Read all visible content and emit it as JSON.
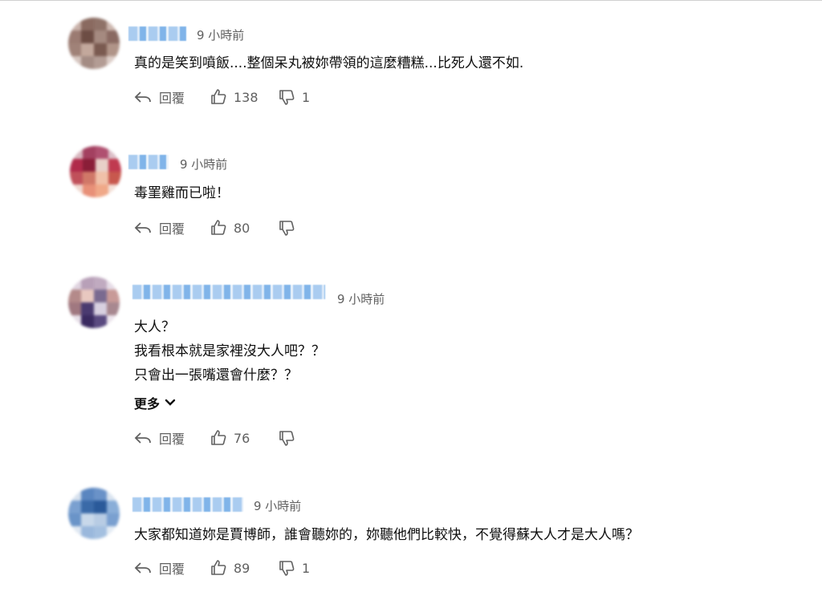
{
  "comments": [
    {
      "time": "9 小時前",
      "lines": [
        "真的是笑到噴飯....整個呆丸被妳帶領的這麼糟糕...比死人還不如."
      ],
      "reply_label": "回覆",
      "likes": "138",
      "dislikes": "1"
    },
    {
      "time": "9 小時前",
      "lines": [
        "毒罣雞而已啦！"
      ],
      "reply_label": "回覆",
      "likes": "80",
      "dislikes": ""
    },
    {
      "time": "9 小時前",
      "lines": [
        "大人？",
        "我看根本就是家裡沒大人吧？？",
        "只會出一張嘴還會什麼？？"
      ],
      "more_label": "更多",
      "reply_label": "回覆",
      "likes": "76",
      "dislikes": ""
    },
    {
      "time": "9 小時前",
      "lines": [
        "大家都知道妳是賈博師，誰會聽妳的，妳聽他們比較快，不覺得蘇大人才是大人嗎？"
      ],
      "reply_label": "回覆",
      "likes": "89",
      "dislikes": "1"
    }
  ],
  "colors": {
    "text": "#0f0f0f",
    "secondary": "#606060",
    "blurred_name": "#6aa8e6"
  }
}
